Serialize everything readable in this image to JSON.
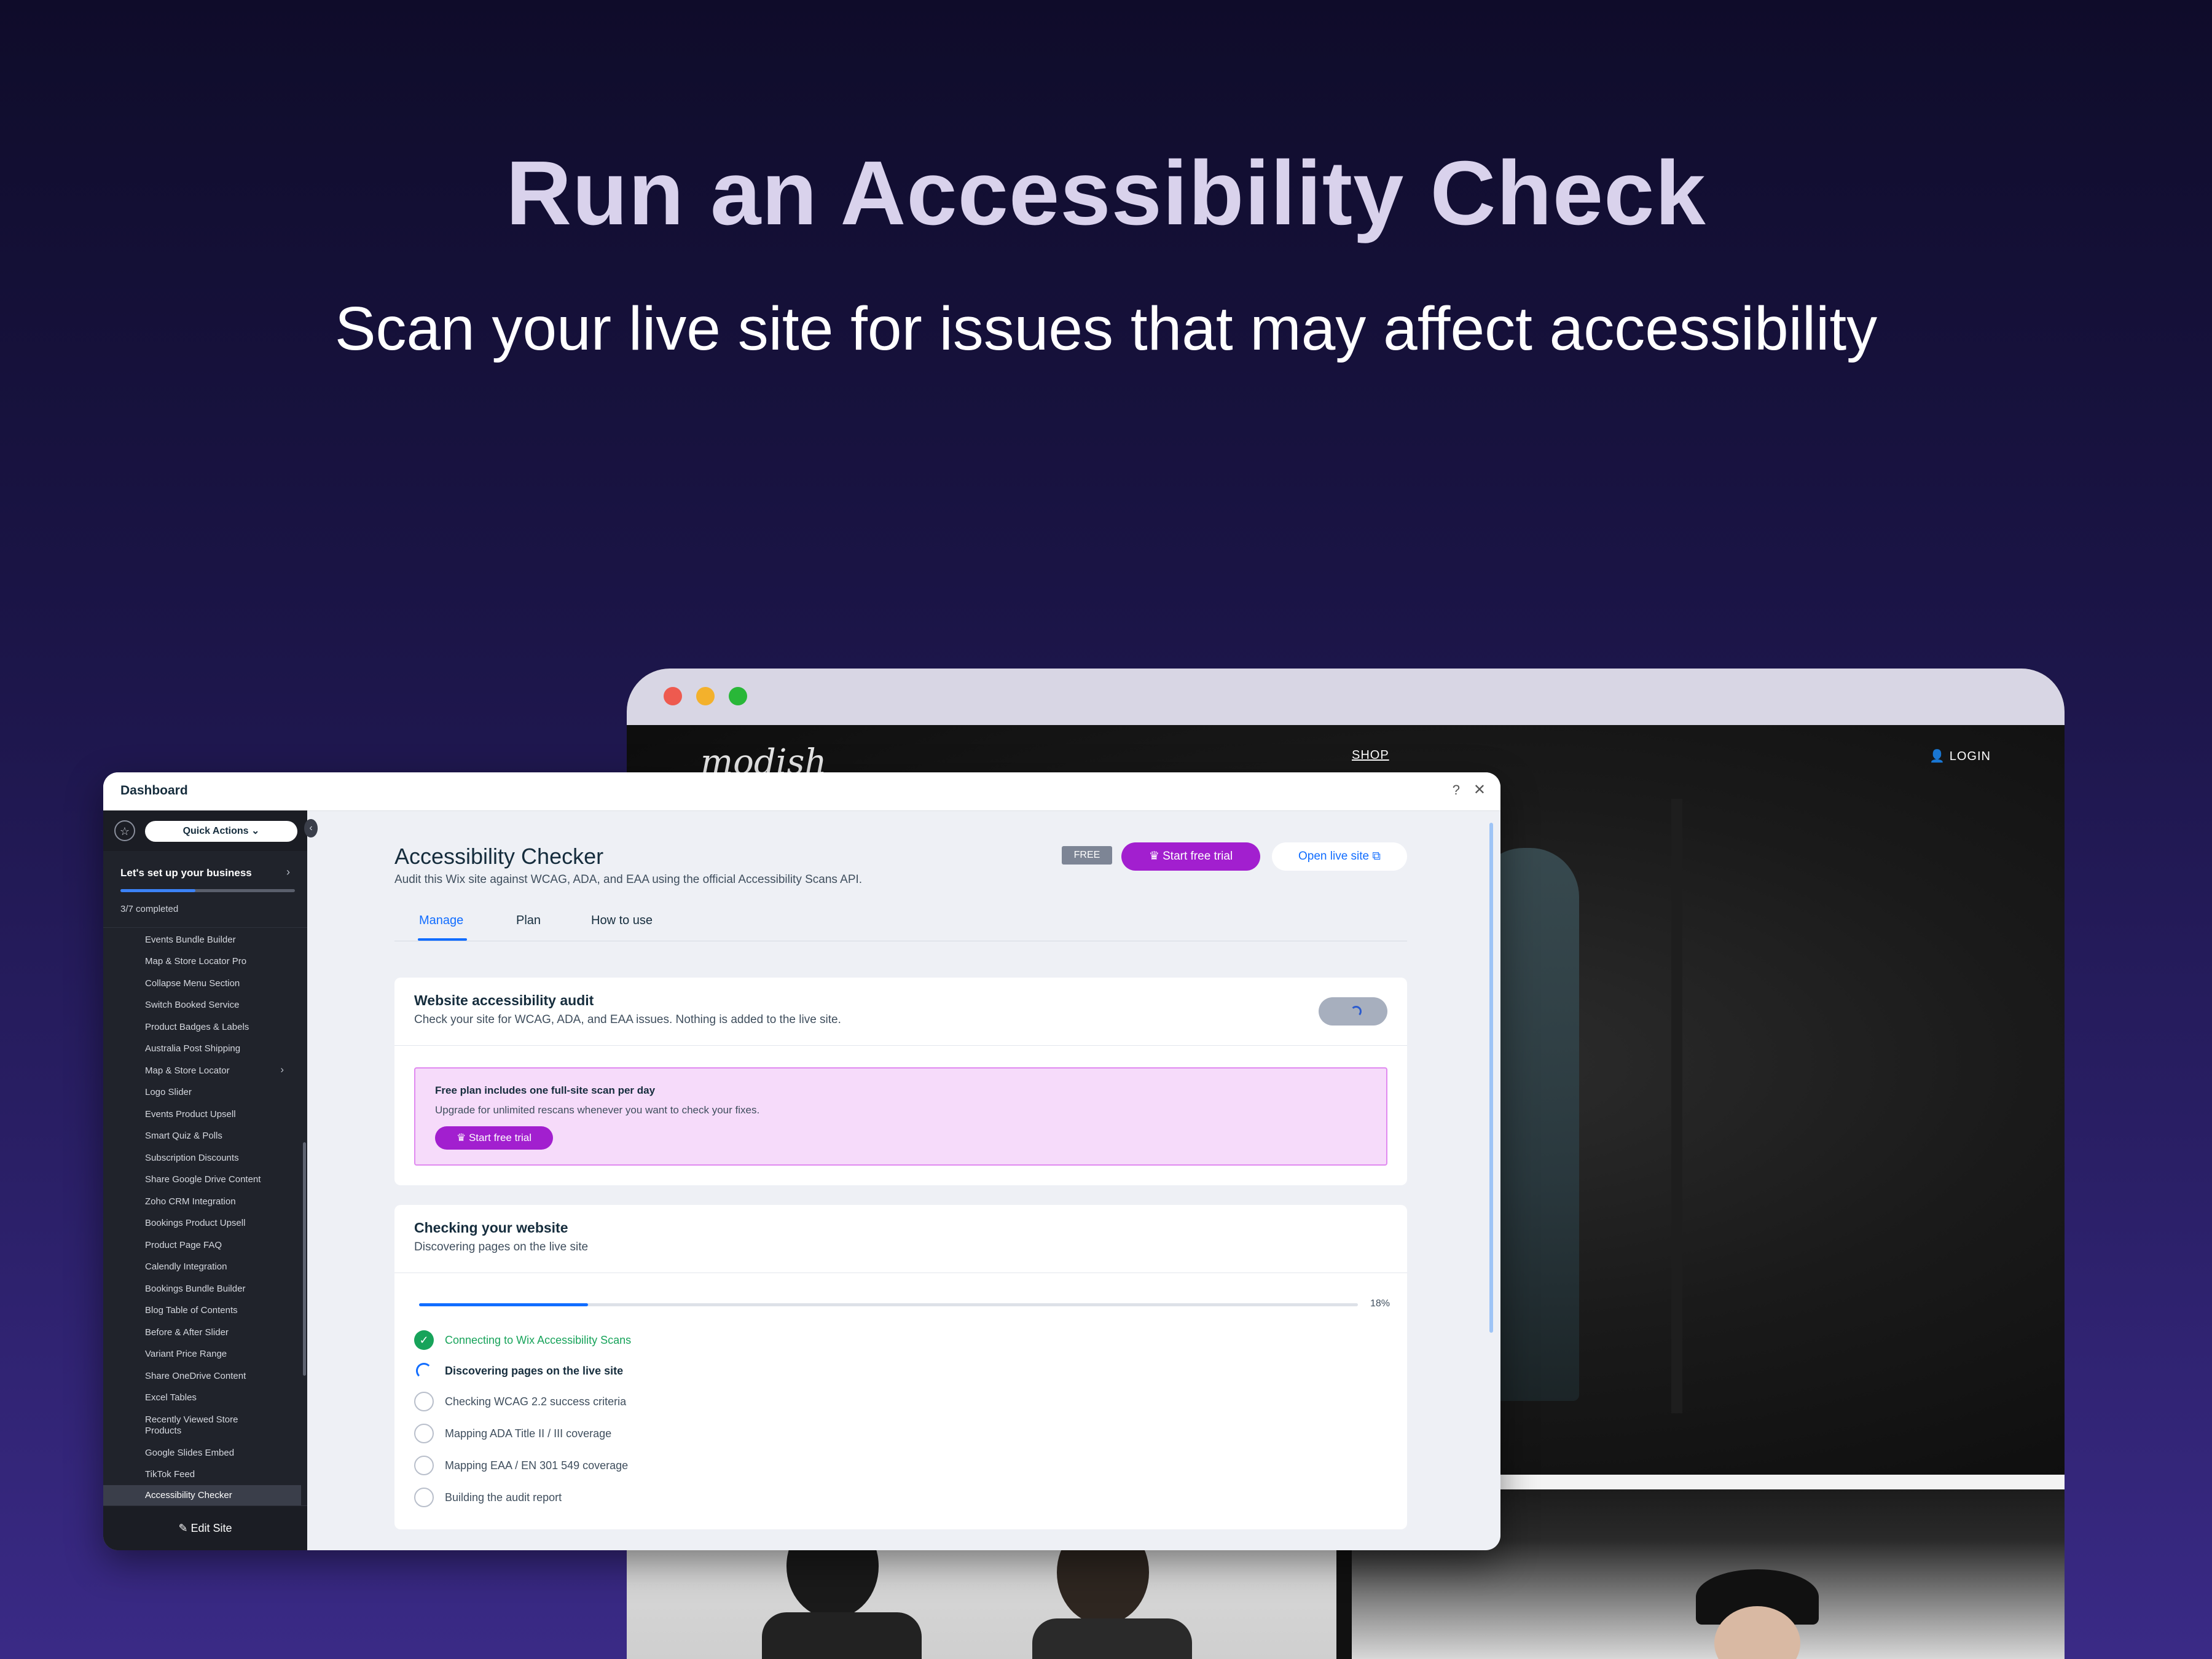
{
  "hero": {
    "title": "Run an Accessibility Check",
    "subtitle": "Scan your live site for issues that may affect accessibility"
  },
  "live_site": {
    "logo": "modish",
    "nav_shop": "SHOP",
    "nav_login": "LOGIN"
  },
  "dashboard": {
    "title": "Dashboard",
    "help": "?",
    "close": "✕"
  },
  "sidebar": {
    "quick_actions": "Quick Actions ⌄",
    "setup_title": "Let's set up your business",
    "setup_progress": 0.43,
    "setup_count": "3/7 completed",
    "items": [
      {
        "label": "Events Bundle Builder"
      },
      {
        "label": "Map & Store Locator Pro"
      },
      {
        "label": "Collapse Menu Section"
      },
      {
        "label": "Switch Booked Service"
      },
      {
        "label": "Product Badges & Labels"
      },
      {
        "label": "Australia Post Shipping"
      },
      {
        "label": "Map & Store Locator"
      },
      {
        "label": "Logo Slider"
      },
      {
        "label": "Events Product Upsell"
      },
      {
        "label": "Smart Quiz & Polls"
      },
      {
        "label": "Subscription Discounts"
      },
      {
        "label": "Share Google Drive Content"
      },
      {
        "label": "Zoho CRM Integration"
      },
      {
        "label": "Bookings Product Upsell"
      },
      {
        "label": "Product Page FAQ"
      },
      {
        "label": "Calendly Integration"
      },
      {
        "label": "Bookings Bundle Builder"
      },
      {
        "label": "Blog Table of Contents"
      },
      {
        "label": "Before & After Slider"
      },
      {
        "label": "Variant Price Range"
      },
      {
        "label": "Share OneDrive Content"
      },
      {
        "label": "Excel Tables"
      },
      {
        "label": "Recently Viewed Store Products"
      },
      {
        "label": "Google Slides Embed"
      },
      {
        "label": "TikTok Feed"
      },
      {
        "label": "Accessibility Checker"
      }
    ],
    "edit_site": "✎ Edit Site"
  },
  "app": {
    "title": "Accessibility Checker",
    "description": "Audit this Wix site against WCAG, ADA, and EAA using the official Accessibility Scans API.",
    "badge": "FREE",
    "trial_button": "♛  Start free trial",
    "open_button": "Open live site  ⧉",
    "tabs": [
      {
        "label": "Manage"
      },
      {
        "label": "Plan"
      },
      {
        "label": "How to use"
      }
    ]
  },
  "audit_card": {
    "title": "Website accessibility audit",
    "subtitle": "Check your site for WCAG, ADA, and EAA issues. Nothing is added to the live site.",
    "promo_title": "Free plan includes one full-site scan per day",
    "promo_text": "Upgrade for unlimited rescans whenever you want to check your fixes.",
    "promo_button": "♛  Start free trial"
  },
  "progress_card": {
    "title": "Checking your website",
    "subtitle": "Discovering pages on the live site",
    "progress": 0.18,
    "progress_label": "18%",
    "steps": [
      {
        "label": "Connecting to Wix Accessibility Scans",
        "state": "done"
      },
      {
        "label": "Discovering pages on the live site",
        "state": "current"
      },
      {
        "label": "Checking WCAG 2.2 success criteria",
        "state": "pending"
      },
      {
        "label": "Mapping ADA Title II / III coverage",
        "state": "pending"
      },
      {
        "label": "Mapping EAA / EN 301 549 coverage",
        "state": "pending"
      },
      {
        "label": "Building the audit report",
        "state": "pending"
      }
    ]
  },
  "colors": {
    "accent_blue": "#116dff",
    "premium_purple": "#a21fcf",
    "success_green": "#17a35a"
  }
}
